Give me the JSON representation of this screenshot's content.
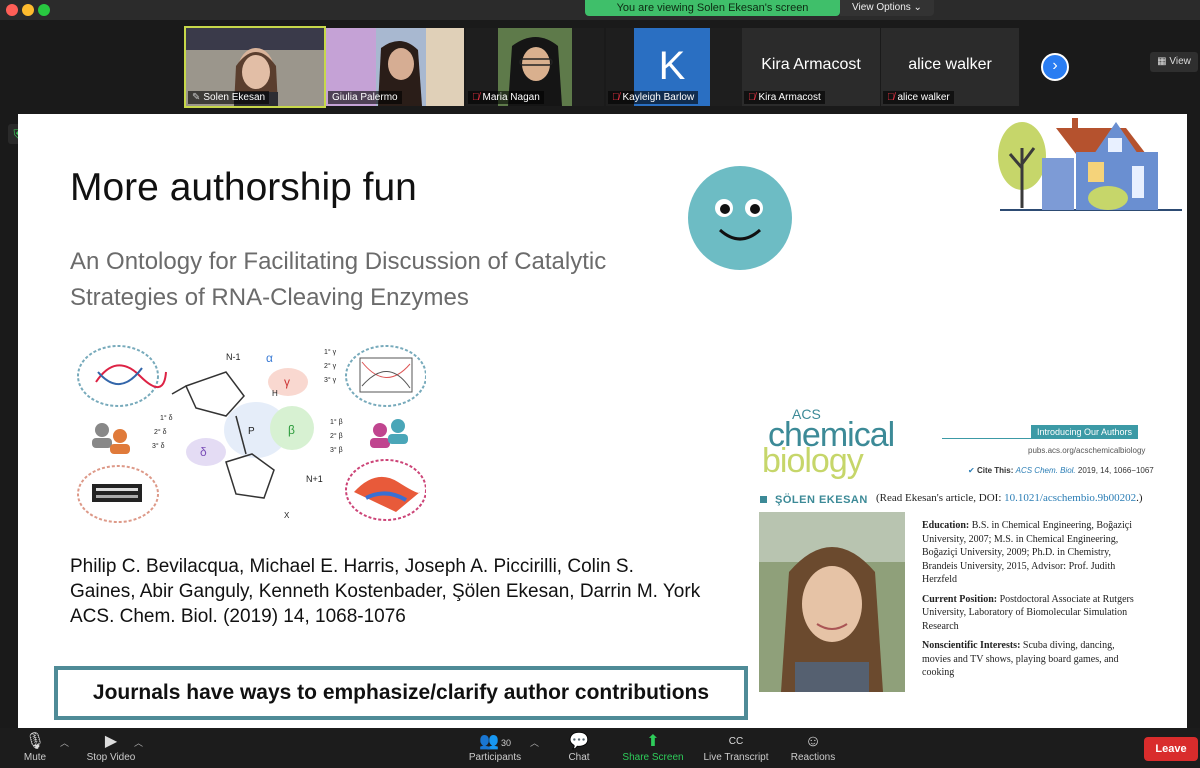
{
  "banner": {
    "viewing": "You are viewing Solen Ekesan's screen",
    "view_options": "View Options ⌄"
  },
  "gallery": {
    "participants": [
      {
        "name": "Solen Ekesan",
        "muted": false,
        "video": true,
        "active": true
      },
      {
        "name": "Giulia Palermo",
        "muted": false,
        "video": true,
        "active": false
      },
      {
        "name": "Maria Nagan",
        "muted": true,
        "video": true,
        "active": false
      },
      {
        "name": "Kayleigh Barlow",
        "muted": true,
        "video": false,
        "initial": "K",
        "active": false
      },
      {
        "name": "Kira Armacost",
        "muted": true,
        "video": false,
        "active": false
      },
      {
        "name": "alice walker",
        "muted": true,
        "video": false,
        "active": false
      }
    ],
    "view_label": "View"
  },
  "slide": {
    "title": "More authorship fun",
    "subtitle": "An Ontology for Facilitating Discussion of Catalytic Strategies of RNA-Cleaving Enzymes",
    "authors_line1": "Philip C. Bevilacqua, Michael E. Harris, Joseph A. Piccirilli, Colin S.",
    "authors_line2": "Gaines, Abir Ganguly, Kenneth Kostenbader, Şölen Ekesan, Darrin M. York",
    "citation": "ACS. Chem. Biol. (2019) 14, 1068-1076",
    "journal_box": "Journals have ways to emphasize/clarify author contributions",
    "diagram": {
      "labels": [
        "N-1",
        "α",
        "1° γ",
        "2° γ",
        "3° γ",
        "γ",
        "β",
        "1° β",
        "2° β",
        "3° β",
        "1° δ",
        "2° δ",
        "3° δ",
        "δ",
        "N+1",
        "P",
        "H",
        "X"
      ]
    },
    "acs": {
      "logo_top": "ACS",
      "logo_chemical": "chemical",
      "logo_biology": "biology",
      "intro": "Introducing Our Authors",
      "url": "pubs.acs.org/acschemicalbiology",
      "cite_label": "Cite This:",
      "cite_journal": "ACS Chem. Biol.",
      "cite_rest": "2019, 14, 1066−1067",
      "author_name": "ŞÖLEN EKESAN",
      "read_note_a": "(Read Ekesan's article, DOI: ",
      "read_note_doi": "10.1021/acschembio.9b00202",
      "read_note_b": ".)",
      "education_label": "Education:",
      "education_text": "B.S. in Chemical Engineering, Boğaziçi University, 2007; M.S. in Chemical Engineering, Boğaziçi University, 2009; Ph.D. in Chemistry, Brandeis University, 2015, Advisor: Prof. Judith Herzfeld",
      "position_label": "Current Position:",
      "position_text": "Postdoctoral Associate at Rutgers University, Laboratory of Biomolecular Simulation Research",
      "interests_label": "Nonscientific Interests:",
      "interests_text": "Scuba diving, dancing, movies and TV shows, playing board games, and cooking"
    }
  },
  "toolbar": {
    "mute": "Mute",
    "stop_video": "Stop Video",
    "participants": "Participants",
    "participants_count": "30",
    "chat": "Chat",
    "share_screen": "Share Screen",
    "live_transcript": "Live Transcript",
    "cc": "CC",
    "reactions": "Reactions",
    "leave": "Leave"
  },
  "colors": {
    "accent_green": "#3fbf6a",
    "leave_red": "#d92c2c",
    "teal": "#4f8b97",
    "smiley": "#6dbcc4"
  }
}
